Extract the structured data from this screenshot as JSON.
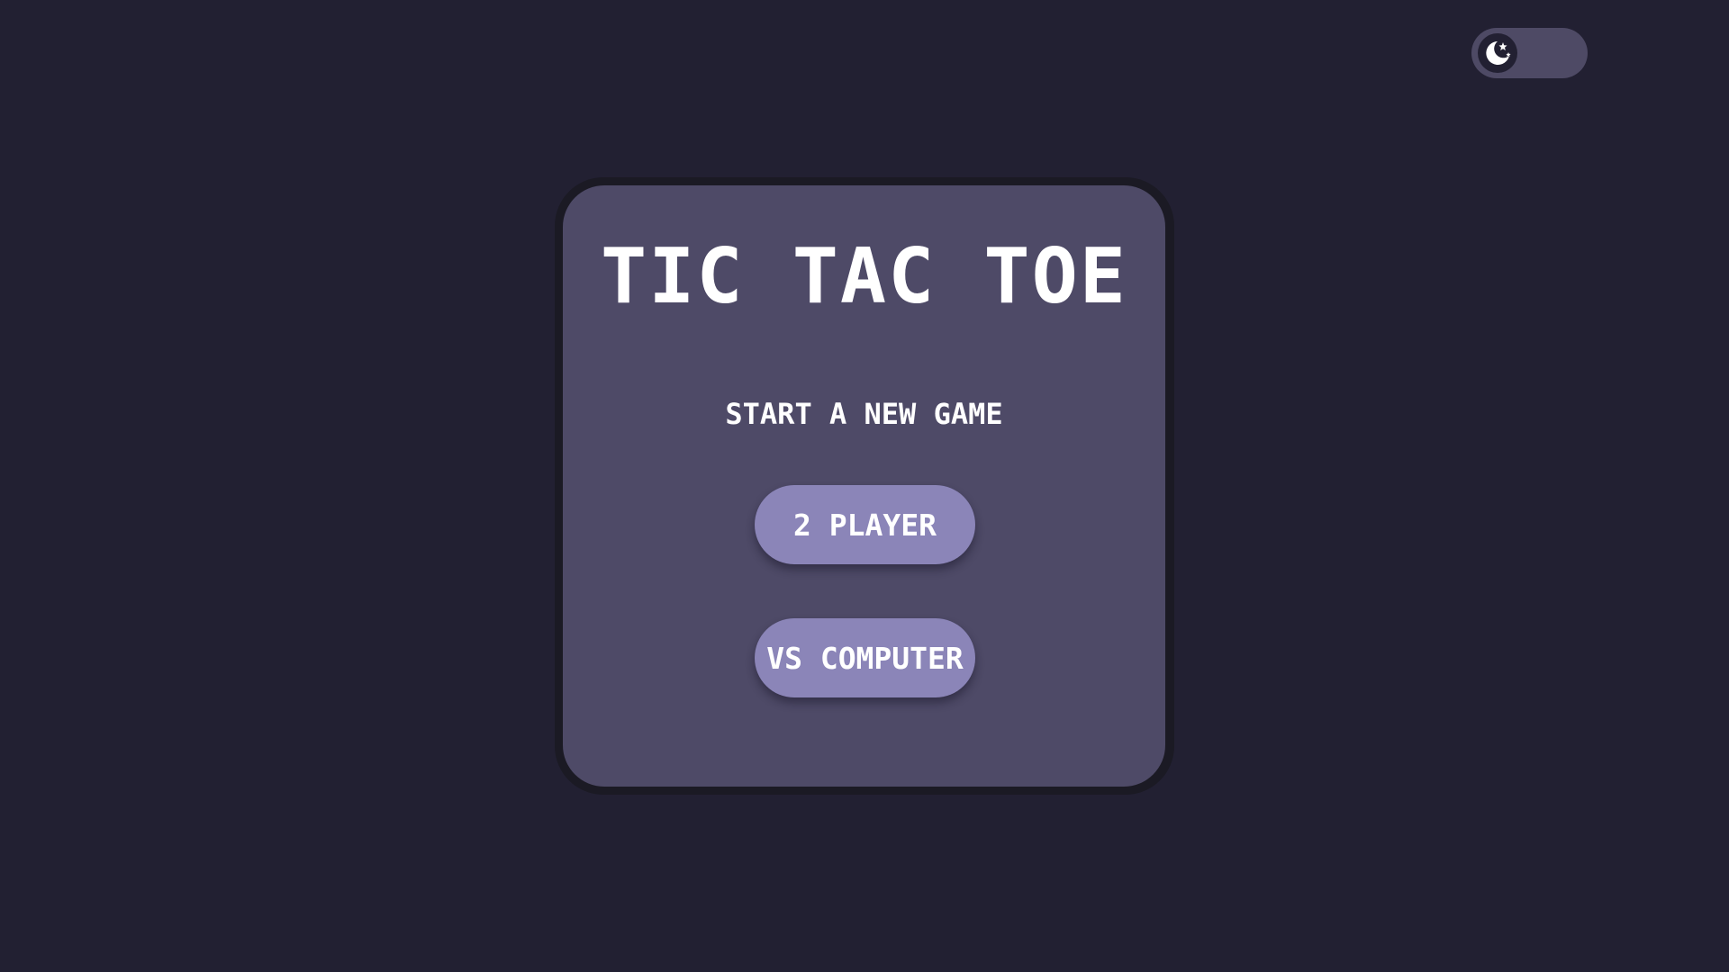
{
  "theme_toggle": {
    "mode": "dark",
    "icon": "moon-stars-icon"
  },
  "game": {
    "title": "TIC TAC TOE",
    "subtitle": "START A NEW GAME",
    "buttons": {
      "two_player": "2 PLAYER",
      "vs_computer": "VS COMPUTER"
    }
  },
  "colors": {
    "background": "#222032",
    "card": "#4e4a67",
    "card_border": "#1b1a24",
    "button": "#8b85b8",
    "toggle_track": "#4e4a65",
    "text": "#ffffff"
  }
}
